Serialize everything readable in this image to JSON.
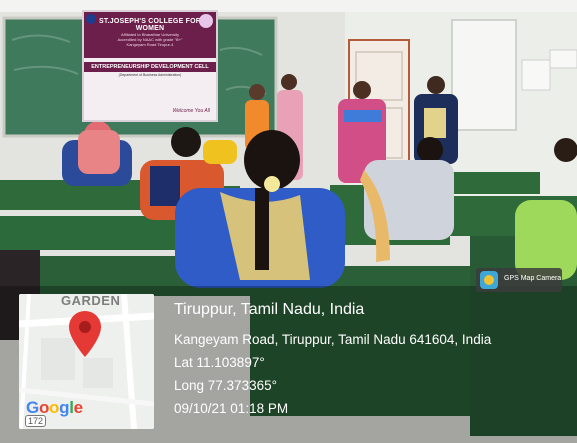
{
  "banner": {
    "title": "ST.JOSEPH'S COLLEGE FOR WOMEN",
    "line1": "Affiliated to Bharathiar University",
    "line2": "Accredited by NAAC with grade \"B+\"",
    "line3": "Kangeyam Road Tirupur-4",
    "cell": "ENTREPRENEURSHIP DEVELOPMENT CELL",
    "dept": "(Department of Business Administration)",
    "welcome": "Welcome You All"
  },
  "watermark": {
    "app_label": "GPS Map Camera",
    "location": "Tiruppur, Tamil Nadu, India",
    "address": "Kangeyam Road, Tiruppur, Tamil Nadu 641604, India",
    "lat": "Lat 11.103897°",
    "long": "Long 77.373365°",
    "datetime": "09/10/21 01:18 PM"
  },
  "map": {
    "area_label": "GARDEN",
    "logo": "Google",
    "road_shield": "172",
    "pin_icon": "map-pin-icon",
    "pin_color": "#e53935"
  },
  "colors": {
    "banner_maroon": "#6b1f4a",
    "wall": "#e8e9e4",
    "chalkboard": "#3f7a5c",
    "desk": "#2f6b3a"
  }
}
